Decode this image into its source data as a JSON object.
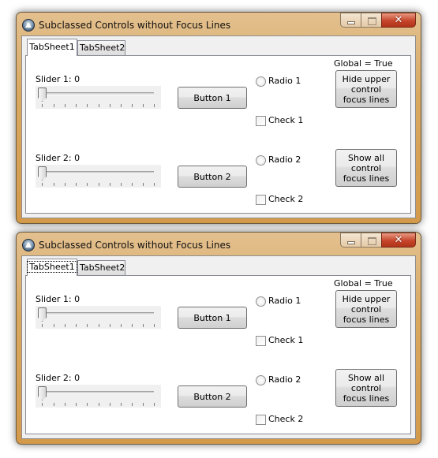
{
  "windows": [
    {
      "title": "Subclassed Controls without Focus Lines",
      "caption_buttons": {
        "minimize": "minimize",
        "maximize": "maximize",
        "close": "✕"
      },
      "tabs": [
        {
          "label": "TabSheet1",
          "active": true,
          "focused": false
        },
        {
          "label": "TabSheet2",
          "active": false,
          "focused": false
        }
      ],
      "global_label": "Global = True",
      "slider1": {
        "label": "Slider 1: 0",
        "value": 0
      },
      "slider2": {
        "label": "Slider 2: 0",
        "value": 0
      },
      "button1": "Button 1",
      "button2": "Button 2",
      "radio1": "Radio 1",
      "radio2": "Radio 2",
      "check1": "Check 1",
      "check2": "Check 2",
      "hide_button": "Hide upper control focus lines",
      "show_button": "Show all control focus lines"
    },
    {
      "title": "Subclassed Controls without Focus Lines",
      "caption_buttons": {
        "minimize": "minimize",
        "maximize": "maximize",
        "close": "✕"
      },
      "tabs": [
        {
          "label": "TabSheet1",
          "active": true,
          "focused": true
        },
        {
          "label": "TabSheet2",
          "active": false,
          "focused": false
        }
      ],
      "global_label": "Global = True",
      "slider1": {
        "label": "Slider 1: 0",
        "value": 0
      },
      "slider2": {
        "label": "Slider 2: 0",
        "value": 0
      },
      "button1": "Button 1",
      "button2": "Button 2",
      "radio1": "Radio 1",
      "radio2": "Radio 2",
      "check1": "Check 1",
      "check2": "Check 2",
      "hide_button": "Hide upper control focus lines",
      "show_button": "Show all control focus lines"
    }
  ]
}
